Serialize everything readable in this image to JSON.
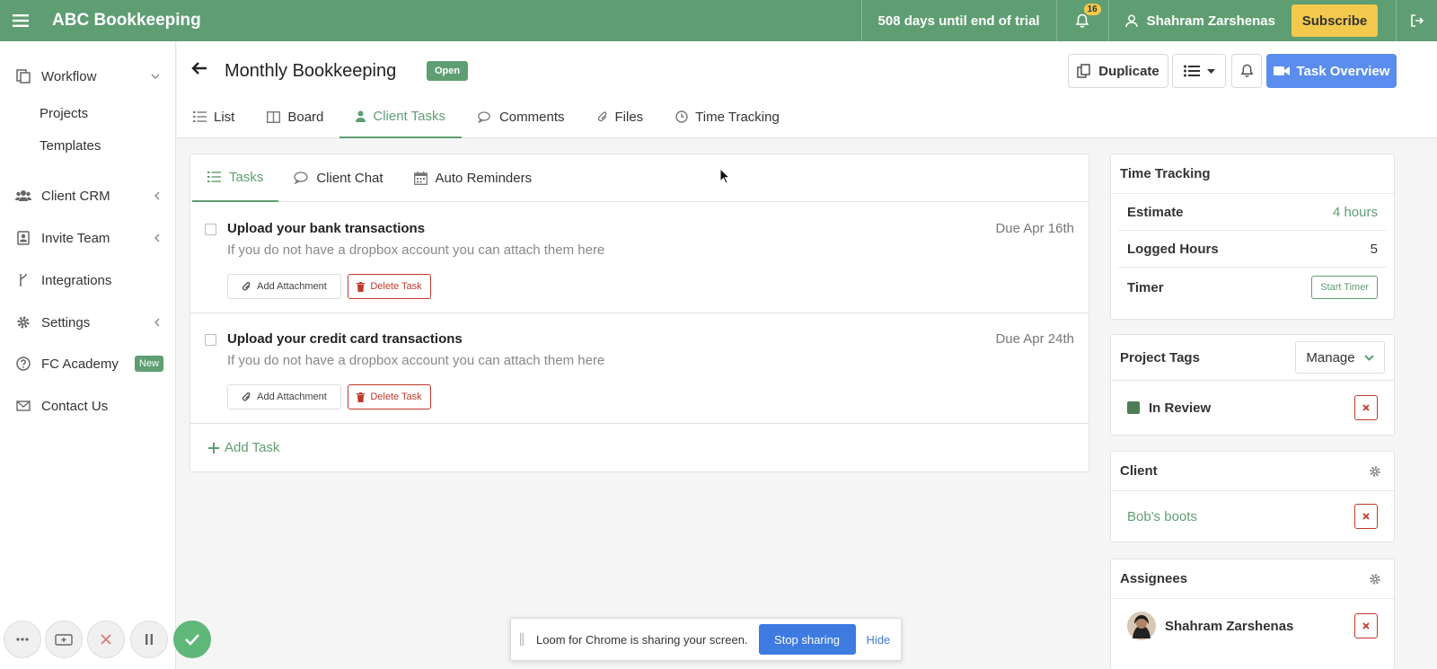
{
  "app": {
    "brand": "ABC Bookkeeping",
    "trial": "508 days until end of trial",
    "notification_count": "16",
    "user_name": "Shahram Zarshenas",
    "subscribe_label": "Subscribe",
    "accent": "#5f9e72"
  },
  "sidebar": {
    "workflow": "Workflow",
    "projects": "Projects",
    "templates": "Templates",
    "client_crm": "Client CRM",
    "invite_team": "Invite Team",
    "integrations": "Integrations",
    "settings": "Settings",
    "fc_academy": "FC Academy",
    "new_badge": "New",
    "contact_us": "Contact Us"
  },
  "header": {
    "title": "Monthly Bookkeeping",
    "status": "Open",
    "duplicate": "Duplicate",
    "task_overview": "Task Overview",
    "tabs": [
      {
        "label": "List",
        "icon": "list-icon"
      },
      {
        "label": "Board",
        "icon": "board-icon"
      },
      {
        "label": "Client Tasks",
        "icon": "user-icon"
      },
      {
        "label": "Comments",
        "icon": "comments-icon"
      },
      {
        "label": "Files",
        "icon": "paperclip-icon"
      },
      {
        "label": "Time Tracking",
        "icon": "clock-icon"
      }
    ],
    "active_tab": "Client Tasks"
  },
  "subtabs": [
    {
      "label": "Tasks",
      "icon": "list-icon"
    },
    {
      "label": "Client Chat",
      "icon": "chat-icon"
    },
    {
      "label": "Auto Reminders",
      "icon": "calendar-icon"
    }
  ],
  "tasks": [
    {
      "title": "Upload your bank transactions",
      "description": "If you do not have a dropbox account you can attach them here",
      "due": "Due Apr 16th"
    },
    {
      "title": "Upload your credit card transactions",
      "description": "If you do not have a dropbox account you can attach them here",
      "due": "Due Apr 24th"
    }
  ],
  "task_actions": {
    "attach": "Add Attachment",
    "delete": "Delete Task",
    "add_task": "Add Task"
  },
  "time_tracking": {
    "title": "Time Tracking",
    "estimate_label": "Estimate",
    "estimate_value": "4 hours",
    "logged_label": "Logged Hours",
    "logged_value": "5",
    "timer_label": "Timer",
    "start_timer": "Start Timer"
  },
  "project_tags": {
    "title": "Project Tags",
    "manage": "Manage",
    "tag": "In Review",
    "tag_color": "#4e7d55"
  },
  "client": {
    "title": "Client",
    "name": "Bob's boots"
  },
  "assignees": {
    "title": "Assignees",
    "name": "Shahram Zarshenas"
  },
  "loom": {
    "text": "Loom for Chrome is sharing your screen.",
    "stop": "Stop sharing",
    "hide": "Hide"
  }
}
